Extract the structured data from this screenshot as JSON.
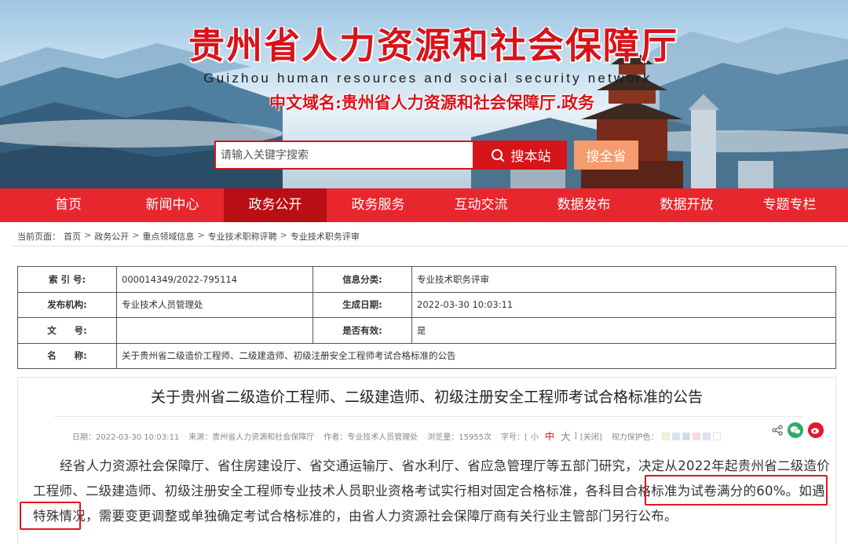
{
  "header": {
    "title": "贵州省人力资源和社会保障厅",
    "subtitle": "Guizhou human resources and social security network",
    "domain": "中文域名:贵州省人力资源和社会保障厅.政务"
  },
  "search": {
    "placeholder": "请输入关键字搜索",
    "site_button": "搜本站",
    "all_button": "搜全省"
  },
  "nav": {
    "items": [
      "首页",
      "新闻中心",
      "政务公开",
      "政务服务",
      "互动交流",
      "数据发布",
      "数据开放",
      "专题专栏"
    ],
    "active_index": 2
  },
  "breadcrumb": {
    "prefix": "当前页面：",
    "items": [
      "首页",
      "政务公开",
      "重点领域信息",
      "专业技术职称评聘",
      "专业技术职务评审"
    ],
    "separator": ">"
  },
  "info": {
    "index_label": "索 引 号:",
    "index_value": "000014349/2022-795114",
    "category_label": "信息分类:",
    "category_value": "专业技术职务评审",
    "org_label": "发布机构:",
    "org_value": "专业技术人员管理处",
    "date_label": "生成日期:",
    "date_value": "2022-03-30 10:03:11",
    "docno_label": "文　　号:",
    "docno_value": "",
    "valid_label": "是否有效:",
    "valid_value": "是",
    "name_label": "名　　称:",
    "name_value": "关于贵州省二级造价工程师、二级建造师、初级注册安全工程师考试合格标准的公告"
  },
  "article": {
    "title": "关于贵州省二级造价工程师、二级建造师、初级注册安全工程师考试合格标准的公告",
    "meta": {
      "date": "日期：2022-03-30 10:03:11",
      "source": "来源：贵州省人力资源和社会保障厅",
      "author": "作者：专业技术人员管理处",
      "views": "浏览量：15955次",
      "font_label": "字号：[",
      "font_small": "小",
      "font_mid": "中",
      "font_big": "大",
      "font_close": "]",
      "close": "[关闭]",
      "eye_care": "视力保护色："
    },
    "swatch_colors": [
      "#faf0c8",
      "#cfe7f6",
      "#c9dcf3",
      "#f6d9e8",
      "#e8dcf3",
      "#ffffff"
    ],
    "paragraph": "经省人力资源社会保障厅、省住房建设厅、省交通运输厅、省水利厅、省应急管理厅等五部门研究，决定从2022年起贵州省二级造价工程师、二级建造师、初级注册安全工程师专业技术人员职业资格考试实行相对固定合格标准，各科目合格标准为试卷满分的60%。如遇特殊情况，需要变更调整或单独确定考试合格标准的，由省人力资源社会保障厅商有关行业主管部门另行公布。"
  },
  "colors": {
    "brand_red": "#d7141a",
    "nav_red": "#e8262d",
    "nav_active": "#b90e13",
    "search_all": "#f49c6d"
  }
}
